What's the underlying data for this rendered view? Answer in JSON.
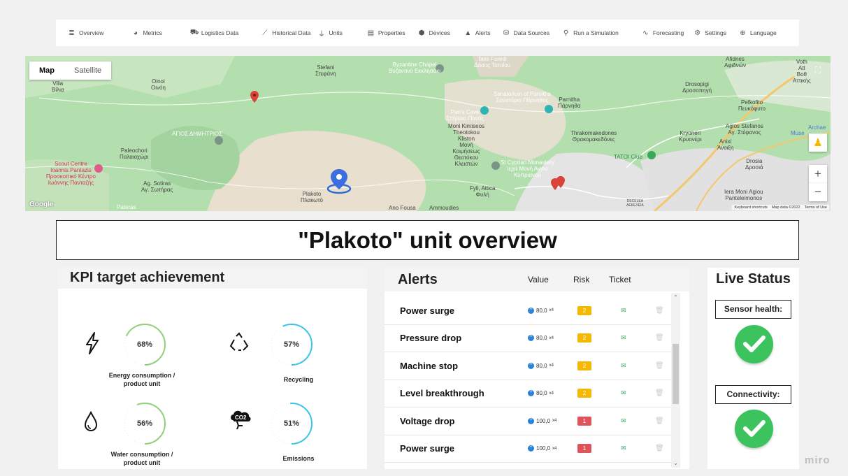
{
  "nav": {
    "items": [
      {
        "label": "Overview",
        "icon": "list-icon",
        "glyph": "≣"
      },
      {
        "label": "Metrics",
        "icon": "gauge-icon",
        "glyph": "◕"
      },
      {
        "label": "Logistics Data",
        "icon": "cart-icon",
        "glyph": "⛟"
      },
      {
        "label": "Historical Data",
        "icon": "line-chart-icon",
        "glyph": "⟋"
      },
      {
        "label": "Units",
        "icon": "plug-icon",
        "glyph": "⏚"
      },
      {
        "label": "Properties",
        "icon": "table-icon",
        "glyph": "▤"
      },
      {
        "label": "Devices",
        "icon": "cube-icon",
        "glyph": "⬢"
      },
      {
        "label": "Alerts",
        "icon": "warning-icon",
        "glyph": "▲"
      },
      {
        "label": "Data Sources",
        "icon": "database-icon",
        "glyph": "⛁"
      },
      {
        "label": "Run a Simulation",
        "icon": "running-icon",
        "glyph": "⚲"
      },
      {
        "label": "Forecasting",
        "icon": "wave-icon",
        "glyph": "∿"
      },
      {
        "label": "Settings",
        "icon": "gear-icon",
        "glyph": "⚙"
      },
      {
        "label": "Language",
        "icon": "globe-icon",
        "glyph": "⊕"
      }
    ]
  },
  "map": {
    "type_map": "Map",
    "type_satellite": "Satellite",
    "google": "Google",
    "keyboard": "Keyboard shortcuts",
    "mapdata": "Map data ©2022",
    "terms": "Terms of Use",
    "labels": {
      "stefani": "Stefani\nΣτεφάνη",
      "vilia": "Vilia\nΒίλια",
      "oinoi": "Oinoi\nΟινόη",
      "chapel": "Byzantine Chapel\nΒυζαντινό Εκκλησάκι",
      "tatoi_forest": "Tatoi Forest\nΔάσος Τατοΐου",
      "sanatorium": "Sanatorium of Parnitha\nΣανατόριο Πάρνηθας",
      "parnitha": "Parnitha\nΠάρνηθα",
      "pans_cave": "Pan's Cave\nΣπήλαιο Πανός",
      "moni": "Moni Kimiseos\nTheotokou\nKliston\nΜονή\nΚοιμήσεως\nΘεοτόκου\nΚλειστών",
      "agios_dimitrios": "ΑΓΙΟΣ ΔΗΜΗΤΡΙΟΣ",
      "paleochori": "Paleochori\nΠαλαιοχώρι",
      "scout": "Scout Centre\nIoannis Pantazis\nΠροσκοπικό Κέντρο\nΙωάννης Πανταζής",
      "sotiras": "Ag. Sotiras\nΑγ. Σωτήρας",
      "plakoto": "Plakoto\nΠλακωτό",
      "patera": "Pateras",
      "ano_fousa": "Ano Fousa",
      "ammoudies": "Ammoudies",
      "cyprian": "St Cyprian Monastery\nΙερά Μονή Αγίου\nΚυπριανού",
      "fyli": "Fyli, Attica\nΦυλή",
      "thrako": "Thrakomakedones\nΘρακομακεδόνες",
      "tatoi_club": "TATOI Club",
      "drosopigi": "Drosopigi\nΔροσοπηγή",
      "pefkofito": "Pefkofito\nΠευκόφυτο",
      "agios_stefanos": "Agios Stefanos\nΑγ. Στέφανος",
      "kryoneri": "Kryoneri\nΚρυονέρι",
      "anixi": "Anixi\nΆνοιξη",
      "drosia": "Drosia\nΔροσιά",
      "ieramoni": "Iera Moni Agiou\nPanteleimonos",
      "dekeleia": "DECELEA\nΔΕΚΕΛΕΙΑ",
      "afidnes": "Afidnes\nΑφιδνών",
      "voth": "Voth\nAtt\nΒοθ\nΑττικής",
      "muse": "Muse",
      "archae": "Archae"
    }
  },
  "title": "\"Plakoto\" unit overview",
  "kpi": {
    "heading": "KPI target achievement",
    "items": [
      {
        "label": "Energy consumption /\nproduct unit",
        "value": 68,
        "display": "68%",
        "icon": "lightning-icon",
        "color": "#8fd07a"
      },
      {
        "label": "Recycling",
        "value": 57,
        "display": "57%",
        "icon": "recycle-icon",
        "color": "#3cc3e8"
      },
      {
        "label": "Water consumption /\nproduct unit",
        "value": 56,
        "display": "56%",
        "icon": "water-drop-icon",
        "color": "#8fd07a"
      },
      {
        "label": "Emissions",
        "value": 51,
        "display": "51%",
        "icon": "co2-cloud-icon",
        "color": "#3cc3e8"
      }
    ]
  },
  "alerts": {
    "heading": "Alerts",
    "col_value": "Value",
    "col_risk": "Risk",
    "col_ticket": "Ticket",
    "rows": [
      {
        "name": "Power surge",
        "value": "80,0",
        "mult": "x4",
        "risk": "2",
        "risk_color": "#f5b800"
      },
      {
        "name": "Pressure drop",
        "value": "80,0",
        "mult": "x4",
        "risk": "2",
        "risk_color": "#f5b800"
      },
      {
        "name": "Machine stop",
        "value": "80,0",
        "mult": "x4",
        "risk": "2",
        "risk_color": "#f5b800"
      },
      {
        "name": "Level breakthrough",
        "value": "80,0",
        "mult": "x4",
        "risk": "2",
        "risk_color": "#f5b800"
      },
      {
        "name": "Voltage drop",
        "value": "100,0",
        "mult": "x4",
        "risk": "1",
        "risk_color": "#e0535b"
      },
      {
        "name": "Power surge",
        "value": "100,0",
        "mult": "x4",
        "risk": "1",
        "risk_color": "#e0535b"
      }
    ]
  },
  "live": {
    "heading": "Live Status",
    "sensor": "Sensor health:",
    "connectivity": "Connectivity:"
  },
  "miro": "miro"
}
